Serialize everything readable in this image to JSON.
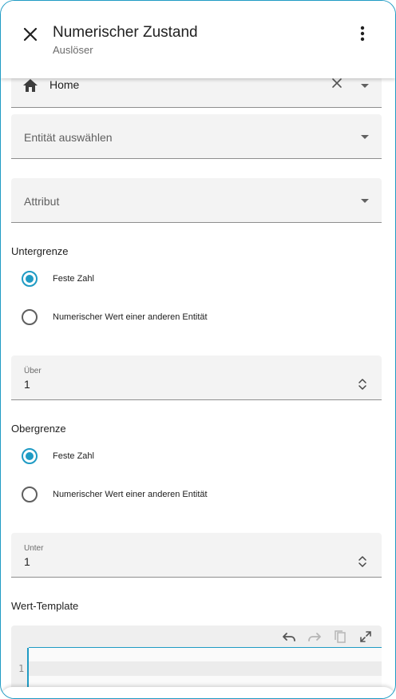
{
  "header": {
    "title": "Numerischer Zustand",
    "subtitle": "Auslöser",
    "close_icon": "close-icon",
    "menu_icon": "more-vertical-icon"
  },
  "area_field": {
    "icon": "home-icon",
    "value": "Home"
  },
  "entity_field": {
    "placeholder": "Entität auswählen"
  },
  "attribute_field": {
    "placeholder": "Attribut"
  },
  "lower": {
    "section_label": "Untergrenze",
    "option_fixed": "Feste Zahl",
    "option_entity": "Numerischer Wert einer anderen Entität",
    "selected": "fixed",
    "field_label": "Über",
    "field_value": "1"
  },
  "upper": {
    "section_label": "Obergrenze",
    "option_fixed": "Feste Zahl",
    "option_entity": "Numerischer Wert einer anderen Entität",
    "selected": "fixed",
    "field_label": "Unter",
    "field_value": "1"
  },
  "template": {
    "section_label": "Wert-Template",
    "line_number": "1",
    "toolbar": [
      "undo-icon",
      "redo-icon",
      "copy-icon",
      "fullscreen-icon"
    ]
  },
  "colors": {
    "accent": "#1f9bc4",
    "field_bg": "#f3f3f3"
  }
}
